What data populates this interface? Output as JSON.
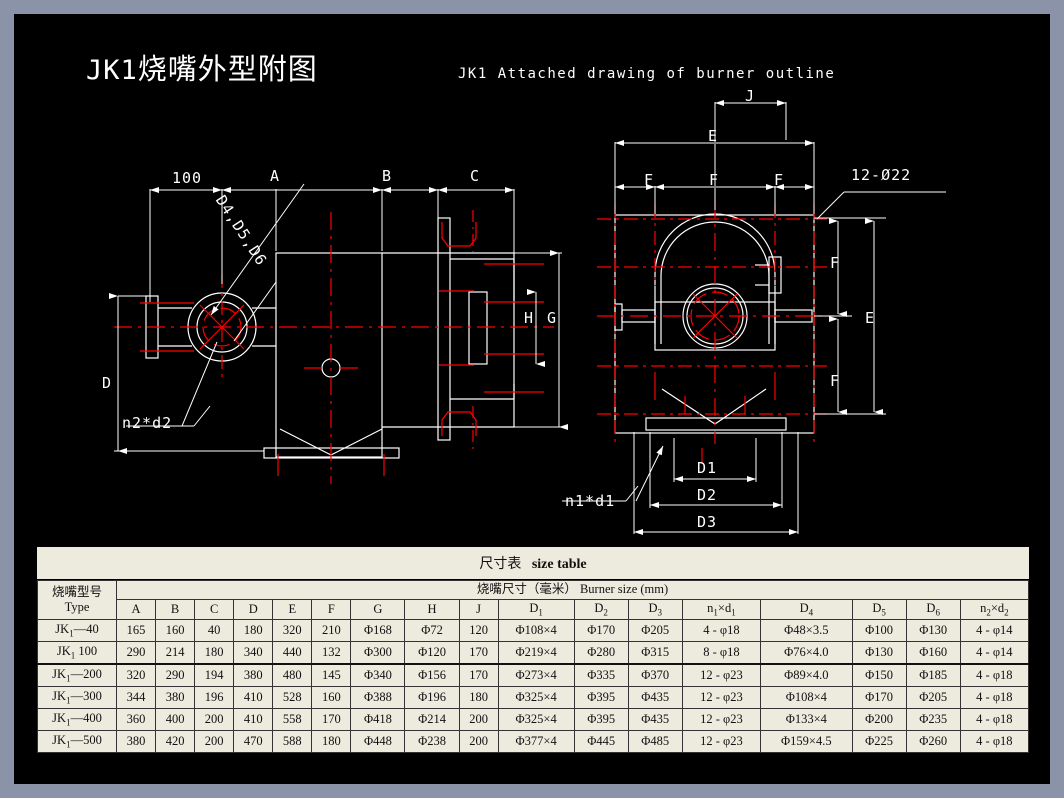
{
  "title": {
    "cn_prefix": "JK1",
    "cn": "烧嘴外型附图",
    "en": "JK1 Attached drawing of burner outline"
  },
  "drawing": {
    "labels": {
      "dim_100": "100",
      "dim_A": "A",
      "dim_B": "B",
      "dim_C": "C",
      "dim_D": "D",
      "dim_E": "E",
      "dim_F": "F",
      "dim_G": "G",
      "dim_H": "H",
      "dim_J": "J",
      "dim_D1": "D1",
      "dim_D2": "D2",
      "dim_D3": "D3",
      "leader_d456": "D4,D5,D6",
      "leader_n2d2": "n2*d2",
      "leader_n1d1": "n1*d1",
      "leader_holes": "12-Ø22"
    },
    "colors": {
      "line": "#ffffff",
      "center": "#ff0000",
      "background": "#000000"
    }
  },
  "table": {
    "title_cn": "尺寸表",
    "title_en": "size table",
    "type_header_cn": "烧嘴型号",
    "type_header_en": "Type",
    "size_header": "烧嘴尺寸（毫米）  Burner size (mm)",
    "columns": [
      "A",
      "B",
      "C",
      "D",
      "E",
      "F",
      "G",
      "H",
      "J",
      "D1",
      "D2",
      "D3",
      "n1×d1",
      "D4",
      "D5",
      "D6",
      "n2×d2"
    ],
    "rows": [
      {
        "type": "JK1—40",
        "cells": [
          "165",
          "160",
          "40",
          "180",
          "320",
          "210",
          "Φ168",
          "Φ72",
          "120",
          "Φ108×4",
          "Φ170",
          "Φ205",
          "4 - φ18",
          "Φ48×3.5",
          "Φ100",
          "Φ130",
          "4 - φ14"
        ]
      },
      {
        "type": "JK1  100",
        "cells": [
          "290",
          "214",
          "180",
          "340",
          "440",
          "132",
          "Φ300",
          "Φ120",
          "170",
          "Φ219×4",
          "Φ280",
          "Φ315",
          "8 - φ18",
          "Φ76×4.0",
          "Φ130",
          "Φ160",
          "4 - φ14"
        ]
      },
      {
        "type": "JK1—200",
        "cells": [
          "320",
          "290",
          "194",
          "380",
          "480",
          "145",
          "Φ340",
          "Φ156",
          "170",
          "Φ273×4",
          "Φ335",
          "Φ370",
          "12 - φ23",
          "Φ89×4.0",
          "Φ150",
          "Φ185",
          "4 - φ18"
        ]
      },
      {
        "type": "JK1—300",
        "cells": [
          "344",
          "380",
          "196",
          "410",
          "528",
          "160",
          "Φ388",
          "Φ196",
          "180",
          "Φ325×4",
          "Φ395",
          "Φ435",
          "12 - φ23",
          "Φ108×4",
          "Φ170",
          "Φ205",
          "4 - φ18"
        ]
      },
      {
        "type": "JK1—400",
        "cells": [
          "360",
          "400",
          "200",
          "410",
          "558",
          "170",
          "Φ418",
          "Φ214",
          "200",
          "Φ325×4",
          "Φ395",
          "Φ435",
          "12 - φ23",
          "Φ133×4",
          "Φ200",
          "Φ235",
          "4 - φ18"
        ]
      },
      {
        "type": "JK1—500",
        "cells": [
          "380",
          "420",
          "200",
          "470",
          "588",
          "180",
          "Φ448",
          "Φ238",
          "200",
          "Φ377×4",
          "Φ445",
          "Φ485",
          "12 - φ23",
          "Φ159×4.5",
          "Φ225",
          "Φ260",
          "4 - φ18"
        ]
      }
    ]
  }
}
